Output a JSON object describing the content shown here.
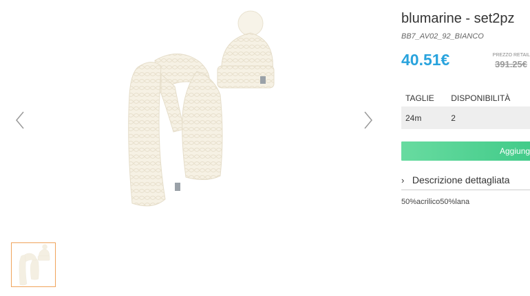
{
  "product": {
    "title": "blumarine - set2pz",
    "sku": "BB7_AV02_92_BIANCO",
    "price": "40.51€",
    "retail_label": "PREZZO RETAIL",
    "retail_price": "391.25€"
  },
  "sizes_table": {
    "headers": [
      "TAGLIE",
      "DISPONIBILITÀ"
    ],
    "rows": [
      [
        "24m",
        "2"
      ]
    ]
  },
  "cart": {
    "add_label": "Aggiung"
  },
  "description": {
    "toggle_label": "Descrizione dettagliata",
    "text": "50%acrilico50%lana"
  },
  "icons": {
    "prev": "chevron-left-icon",
    "next": "chevron-right-icon",
    "toggle": "chevron-right-icon"
  },
  "colors": {
    "price": "#29a3dd",
    "add_button": "#4fd394",
    "thumb_border": "#f0a35a"
  }
}
